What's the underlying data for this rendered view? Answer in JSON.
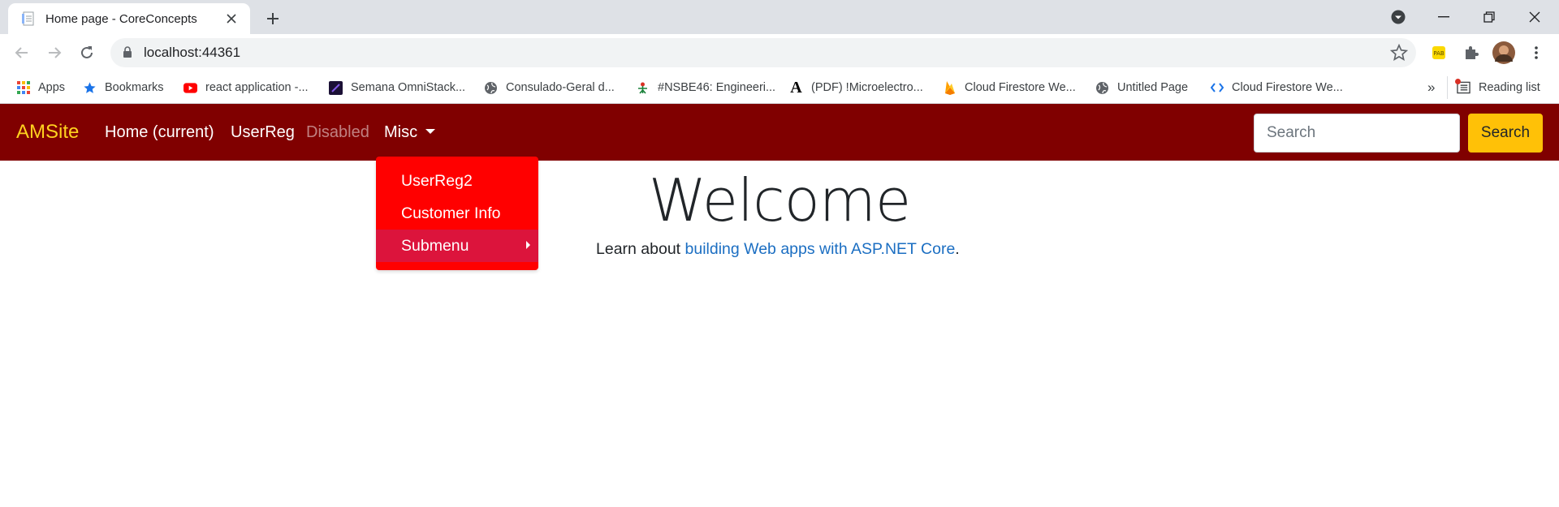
{
  "browser": {
    "tab_title": "Home page - CoreConcepts",
    "url": "localhost:44361",
    "bookmarks": [
      {
        "label": "Apps",
        "icon": "apps-grid-icon"
      },
      {
        "label": "Bookmarks",
        "icon": "star-icon"
      },
      {
        "label": "react application -...",
        "icon": "youtube-icon"
      },
      {
        "label": "Semana OmniStack...",
        "icon": "omnistack-icon"
      },
      {
        "label": "Consulado-Geral d...",
        "icon": "globe-icon"
      },
      {
        "label": "#NSBE46: Engineeri...",
        "icon": "nsbe-icon"
      },
      {
        "label": "(PDF) !Microelectro...",
        "icon": "academia-icon"
      },
      {
        "label": "Cloud Firestore We...",
        "icon": "firebase-icon"
      },
      {
        "label": "Untitled Page",
        "icon": "globe-icon"
      },
      {
        "label": "Cloud Firestore We...",
        "icon": "code-icon"
      }
    ],
    "more_bookmarks": "»",
    "reading_list": "Reading list"
  },
  "navbar": {
    "brand": "AMSite",
    "links": [
      "Home (current)",
      "UserReg",
      "Disabled",
      "Misc"
    ],
    "search_placeholder": "Search",
    "search_button": "Search",
    "colors": {
      "bar": "#800000",
      "brand": "#ffd21f",
      "button": "#ffc107"
    }
  },
  "dropdown": {
    "items": [
      "UserReg2",
      "Customer Info",
      "Submenu"
    ],
    "colors": {
      "bg": "#ff0000",
      "active": "#dc143c"
    }
  },
  "main": {
    "title": "Welcome",
    "lead_prefix": "Learn about ",
    "lead_link": "building Web apps with ASP.NET Core",
    "lead_suffix": "."
  }
}
